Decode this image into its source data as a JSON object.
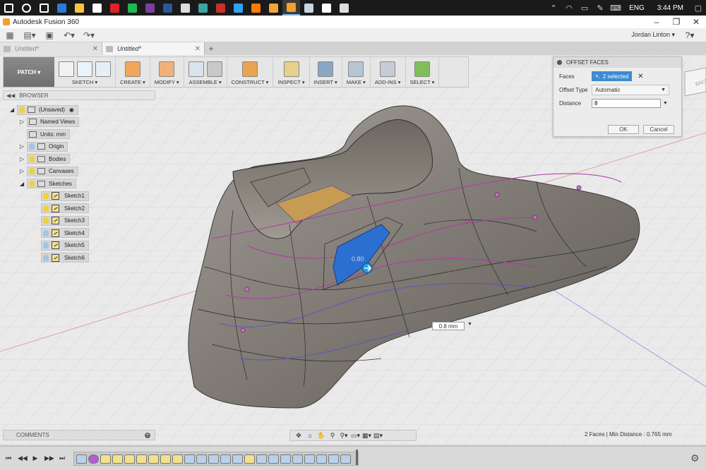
{
  "window": {
    "title": "Autodesk Fusion 360"
  },
  "taskbar": {
    "apps": [
      {
        "icon": "windows-start-icon",
        "color": "#ffffff"
      },
      {
        "icon": "search-icon",
        "color": "#ffffff"
      },
      {
        "icon": "task-view-icon",
        "color": "#ffffff"
      },
      {
        "icon": "edge-icon",
        "color": "#2b7cd3"
      },
      {
        "icon": "file-explorer-icon",
        "color": "#f5c542"
      },
      {
        "icon": "store-icon",
        "color": "#ffffff"
      },
      {
        "icon": "opera-icon",
        "color": "#e0222a"
      },
      {
        "icon": "spotify-icon",
        "color": "#1db954"
      },
      {
        "icon": "onenote-icon",
        "color": "#7b3fa1"
      },
      {
        "icon": "word-icon",
        "color": "#2b5797"
      },
      {
        "icon": "mail-icon",
        "color": "#dddddd"
      },
      {
        "icon": "camera-icon",
        "color": "#3aa6a6"
      },
      {
        "icon": "app-s-icon",
        "color": "#c9302c"
      },
      {
        "icon": "photoshop-icon",
        "color": "#2fa3f7"
      },
      {
        "icon": "illustrator-icon",
        "color": "#ff7c00"
      },
      {
        "icon": "paint-icon",
        "color": "#f2a33a"
      },
      {
        "icon": "fusion360-icon",
        "color": "#f0a030"
      },
      {
        "icon": "steam-icon",
        "color": "#c7d5e0"
      },
      {
        "icon": "record-icon",
        "color": "#ffffff"
      },
      {
        "icon": "photos-icon",
        "color": "#dddddd"
      }
    ],
    "language": "ENG",
    "time": "3:44 PM"
  },
  "qat": {
    "user": "Jordan Linton ▾"
  },
  "tabs": [
    {
      "label": "Untitled*",
      "active": false
    },
    {
      "label": "Untitled*",
      "active": true
    }
  ],
  "toolbar": {
    "workspace": "PATCH ▾",
    "groups": [
      {
        "label": "SKETCH ▾",
        "icons": [
          "create-sketch-icon",
          "spline-icon",
          "rectangle-icon"
        ]
      },
      {
        "label": "CREATE ▾",
        "icons": [
          "extrude-patch-icon"
        ]
      },
      {
        "label": "MODIFY ▾",
        "icons": [
          "press-pull-icon"
        ]
      },
      {
        "label": "ASSEMBLE ▾",
        "icons": [
          "new-component-icon",
          "joint-icon"
        ]
      },
      {
        "label": "CONSTRUCT ▾",
        "icons": [
          "offset-plane-icon"
        ]
      },
      {
        "label": "INSPECT ▾",
        "icons": [
          "measure-icon"
        ]
      },
      {
        "label": "INSERT ▾",
        "icons": [
          "insert-image-icon"
        ]
      },
      {
        "label": "MAKE ▾",
        "icons": [
          "make-icon"
        ]
      },
      {
        "label": "ADD-INS ▾",
        "icons": [
          "scripts-icon"
        ]
      },
      {
        "label": "SELECT ▾",
        "icons": [
          "select-icon"
        ]
      }
    ]
  },
  "browser": {
    "title": "BROWSER",
    "root": "(Unsaved)",
    "items": [
      {
        "label": "Named Views",
        "type": "folder"
      },
      {
        "label": "Units: mm",
        "type": "doc"
      },
      {
        "label": "Origin",
        "type": "folder"
      },
      {
        "label": "Bodies",
        "type": "folder"
      },
      {
        "label": "Canvases",
        "type": "folder"
      },
      {
        "label": "Sketches",
        "type": "folder"
      }
    ],
    "sketches": [
      "Sketch1",
      "Sketch2",
      "Sketch3",
      "Sketch4",
      "Sketch5",
      "Sketch6"
    ]
  },
  "dialog": {
    "title": "OFFSET FACES",
    "faces_label": "Faces",
    "faces_value": "2 selected",
    "offset_type_label": "Offset Type",
    "offset_type_value": "Automatic",
    "distance_label": "Distance",
    "distance_value": "8",
    "ok": "OK",
    "cancel": "Cancel"
  },
  "viewcube": {
    "face": "BACK"
  },
  "canvas": {
    "dimension_label": "0.8 mm",
    "value_overlay": "0.80"
  },
  "comments": {
    "title": "COMMENTS"
  },
  "status": {
    "text": "2 Faces | Min Distance : 0.765 mm"
  },
  "colors": {
    "selection": "#3d8bd1",
    "model": "#86817b",
    "sketch_curve": "#b03aa0"
  }
}
